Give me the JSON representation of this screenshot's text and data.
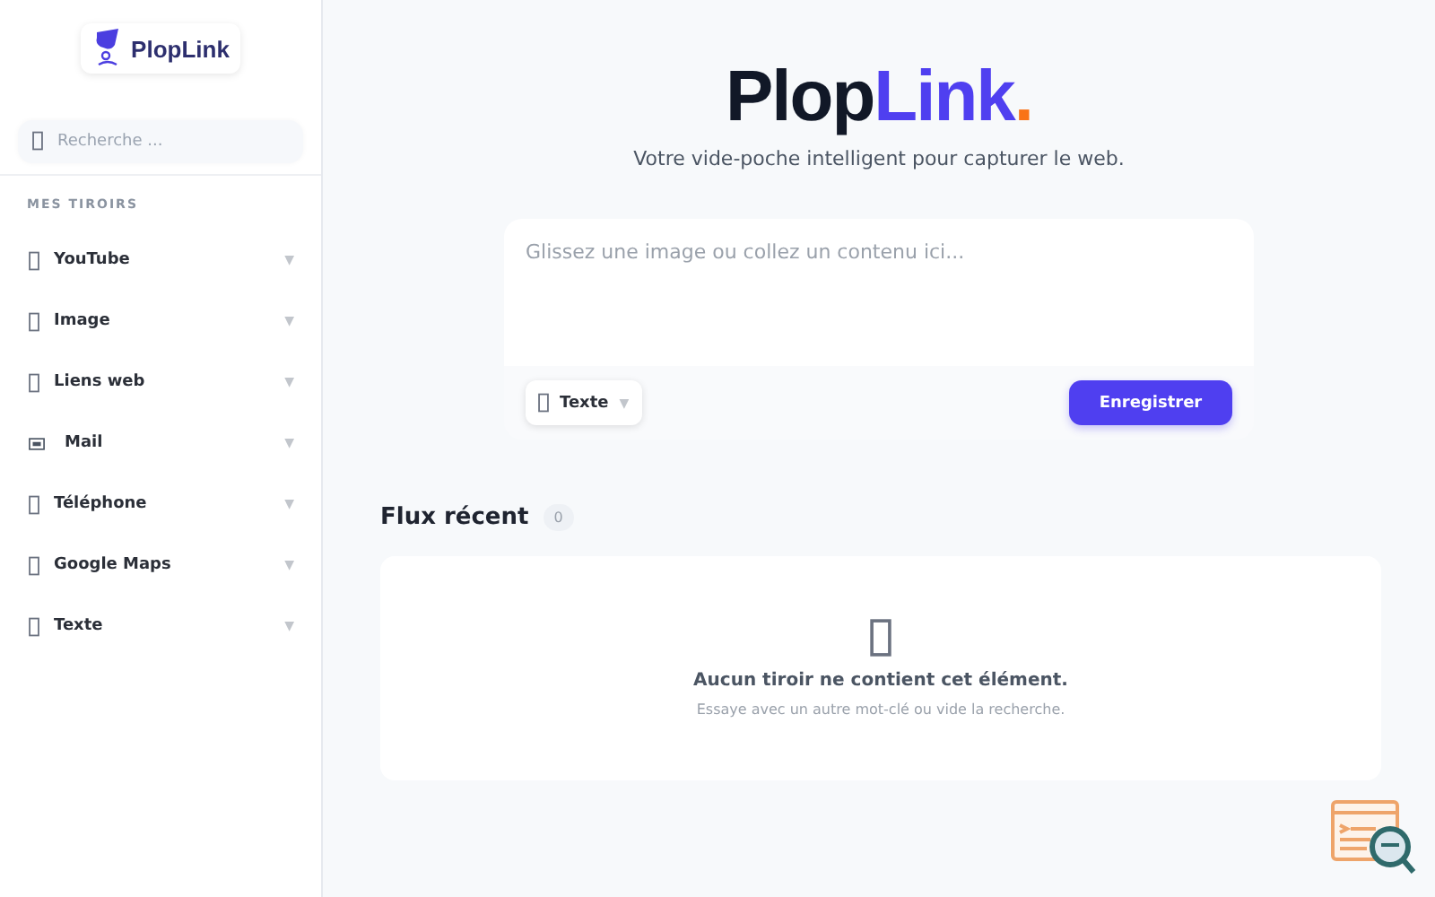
{
  "sidebar": {
    "brand": "PlopLink",
    "search": {
      "placeholder": "Recherche ..."
    },
    "section_title": "MES TIROIRS",
    "items": [
      {
        "label": "YouTube",
        "caret": "▼"
      },
      {
        "label": "Image",
        "caret": "▼"
      },
      {
        "label": "Liens web",
        "caret": "▼"
      },
      {
        "label": "Mail",
        "caret": "▼"
      },
      {
        "label": "Téléphone",
        "caret": "▼"
      },
      {
        "label": "Google Maps",
        "caret": "▼"
      },
      {
        "label": "Texte",
        "caret": "▼"
      }
    ]
  },
  "hero": {
    "title_dark": "Plop",
    "title_accent": "Link",
    "title_dot": ".",
    "tagline": "Votre vide-poche intelligent pour capturer le web."
  },
  "composer": {
    "placeholder": "Glissez une image ou collez un contenu ici...",
    "type_select": {
      "label": "Texte",
      "caret": "▼"
    },
    "save_button": "Enregistrer"
  },
  "feed": {
    "title": "Flux récent",
    "count": "0",
    "empty_title": "Aucun tiroir ne contient cet élément.",
    "empty_hint": "Essaye avec un autre mot-clé ou vide la recherche."
  }
}
